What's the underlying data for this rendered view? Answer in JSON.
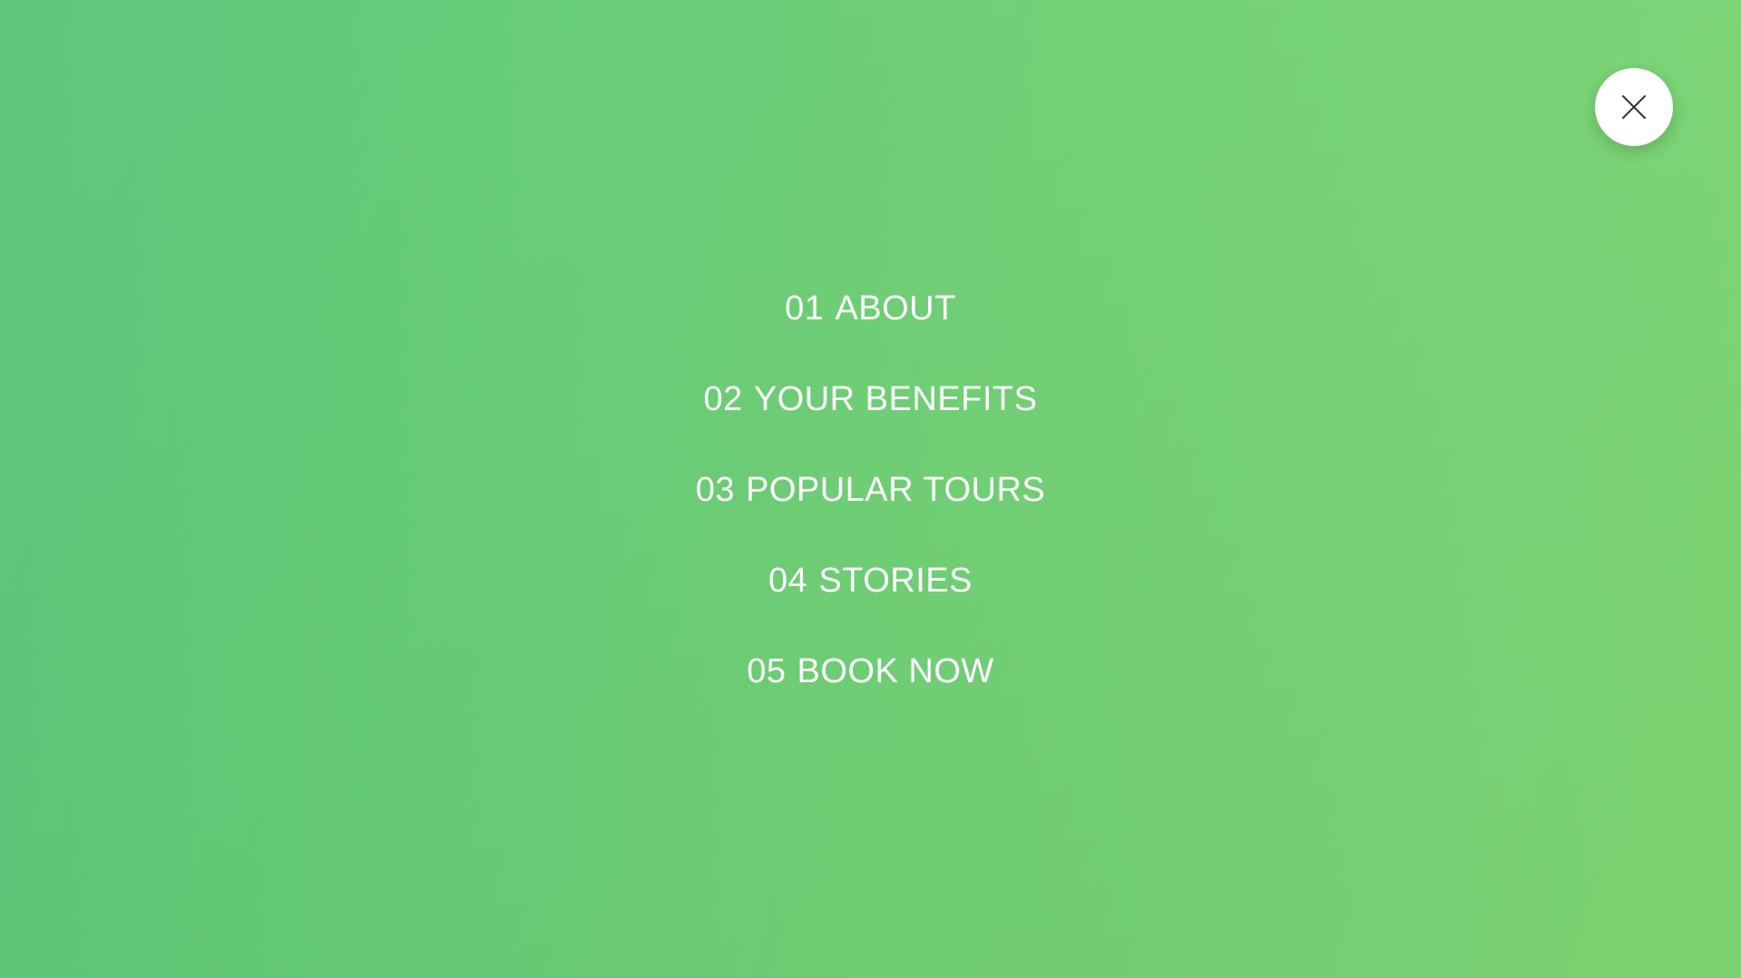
{
  "theme": {
    "gradient_start": "#5bc57a",
    "gradient_end": "#7dd672",
    "text_color": "#ffffff",
    "close_bg": "#ffffff",
    "close_icon_color": "#333333"
  },
  "close_button": {
    "icon": "close-icon"
  },
  "nav": {
    "items": [
      {
        "number": "01",
        "label": "ABOUT"
      },
      {
        "number": "02",
        "label": "YOUR BENEFITS"
      },
      {
        "number": "03",
        "label": "POPULAR TOURS"
      },
      {
        "number": "04",
        "label": "STORIES"
      },
      {
        "number": "05",
        "label": "BOOK NOW"
      }
    ]
  }
}
